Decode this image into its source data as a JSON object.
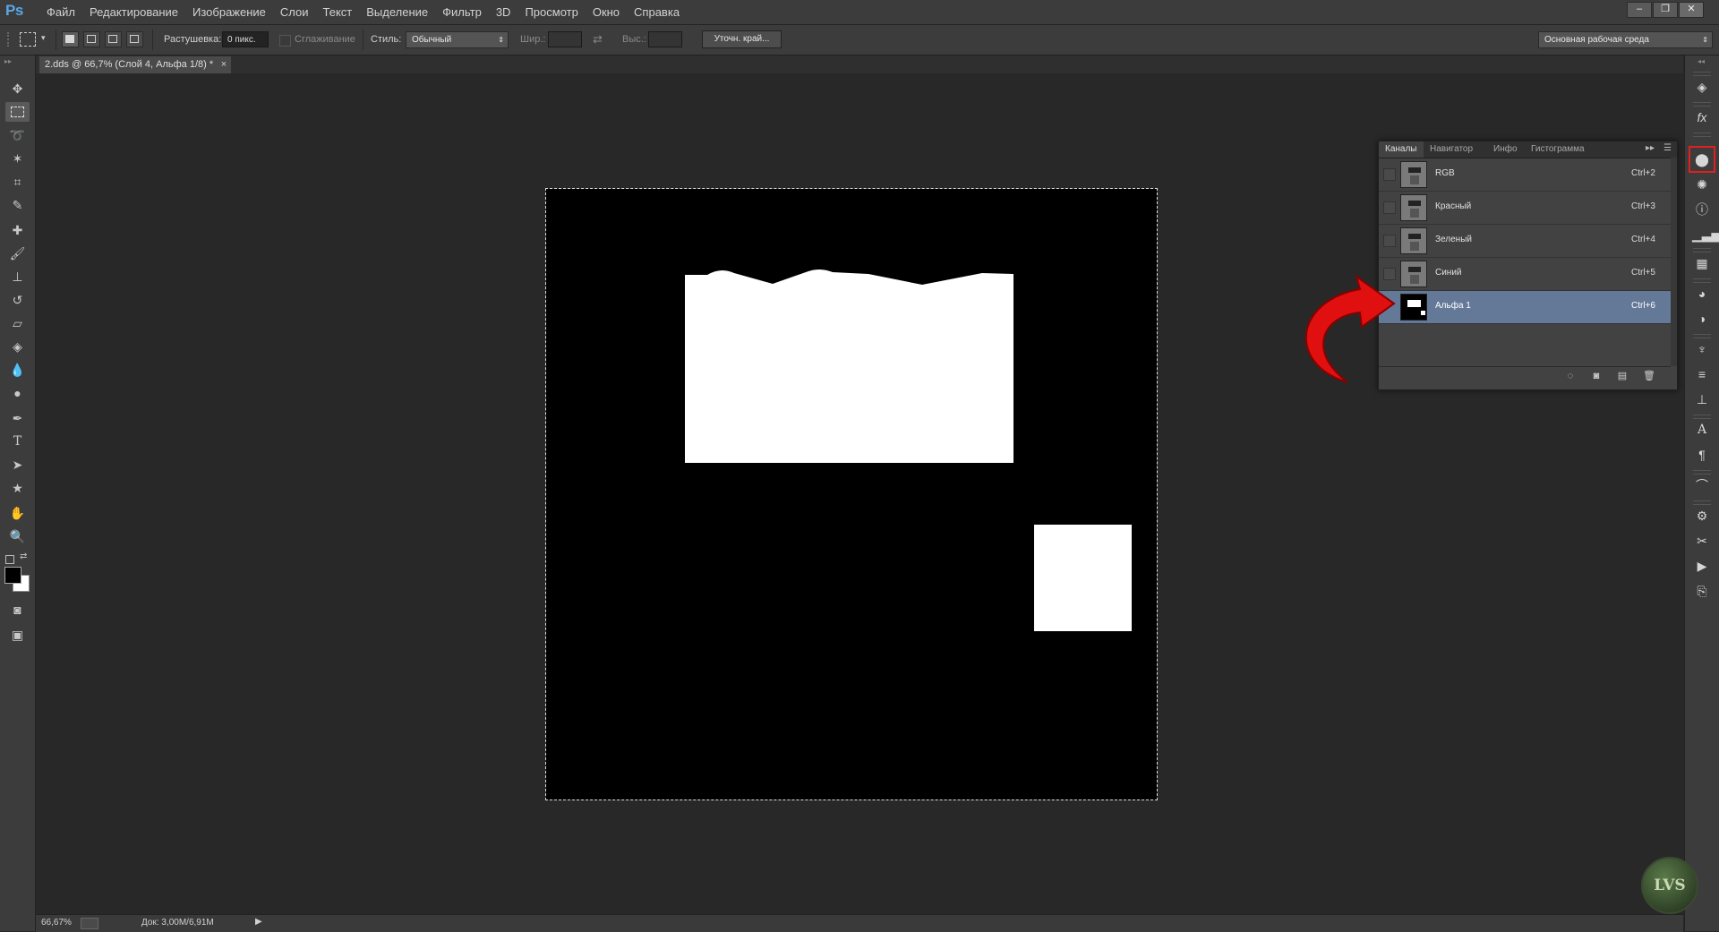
{
  "app": {
    "logo": "Ps"
  },
  "menu": [
    "Файл",
    "Редактирование",
    "Изображение",
    "Слои",
    "Текст",
    "Выделение",
    "Фильтр",
    "3D",
    "Просмотр",
    "Окно",
    "Справка"
  ],
  "window_controls": {
    "minimize": "–",
    "restore": "❐",
    "close": "✕"
  },
  "options": {
    "feather_label": "Растушевка:",
    "feather_value": "0 пикс.",
    "antialias_label": "Сглаживание",
    "style_label": "Стиль:",
    "style_value": "Обычный",
    "width_label": "Шир.:",
    "height_label": "Выс.:",
    "refine_button": "Уточн. край...",
    "workspace_value": "Основная рабочая среда"
  },
  "document_tab": {
    "title": "2.dds @ 66,7% (Слой 4, Альфа 1/8) *",
    "close": "×"
  },
  "channels_panel": {
    "tabs": [
      "Каналы",
      "Навигатор",
      "Инфо",
      "Гистограмма"
    ],
    "active_tab": "Каналы",
    "channels": [
      {
        "name": "RGB",
        "shortcut": "Ctrl+2",
        "selected": false
      },
      {
        "name": "Красный",
        "shortcut": "Ctrl+3",
        "selected": false
      },
      {
        "name": "Зеленый",
        "shortcut": "Ctrl+4",
        "selected": false
      },
      {
        "name": "Синий",
        "shortcut": "Ctrl+5",
        "selected": false
      },
      {
        "name": "Альфа 1",
        "shortcut": "Ctrl+6",
        "selected": true
      }
    ]
  },
  "status": {
    "zoom": "66,67%",
    "doc": "Док: 3,00M/6,91M"
  },
  "colors": {
    "accent_selected": "#647898",
    "annotation_arrow": "#e01010",
    "highlight_box": "#e02020"
  },
  "watermark": "LVS"
}
